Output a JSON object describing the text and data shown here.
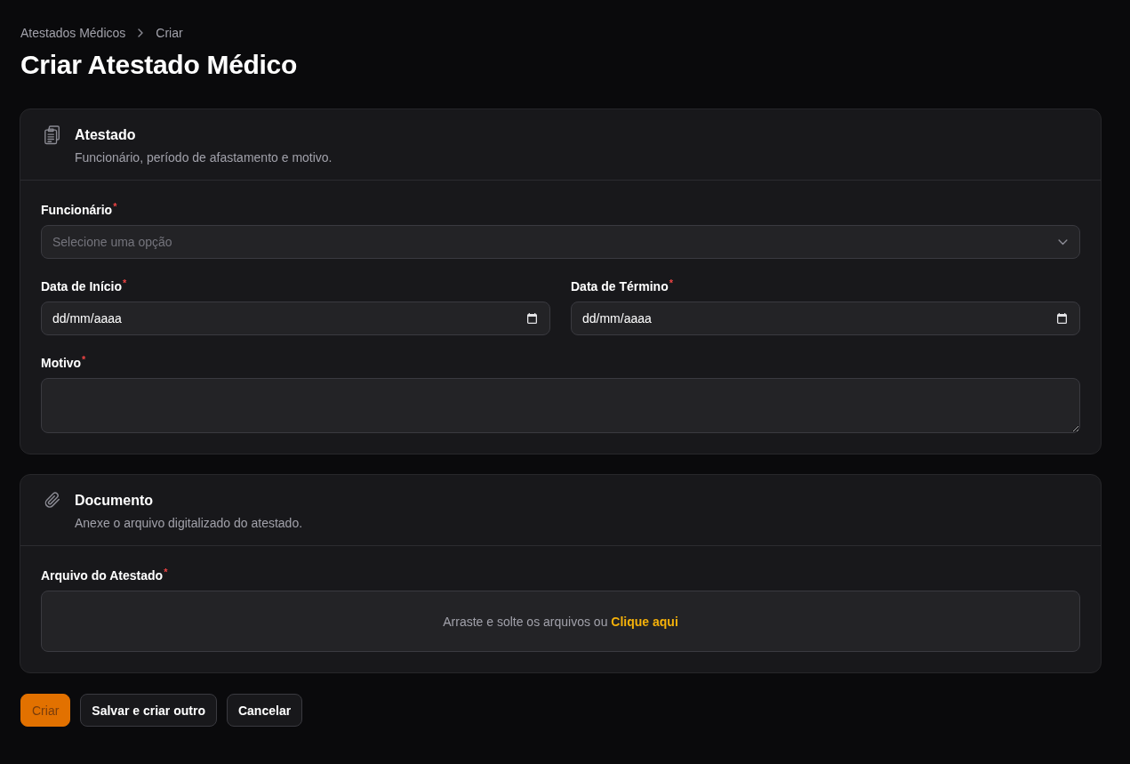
{
  "breadcrumbs": [
    {
      "label": "Atestados Médicos"
    },
    {
      "label": "Criar"
    }
  ],
  "page_title": "Criar Atestado Médico",
  "sections": [
    {
      "title": "Atestado",
      "description": "Funcionário, período de afastamento e motivo.",
      "fields": [
        {
          "kind": "select",
          "label": "Funcionário",
          "required_mark": "*",
          "placeholder": "Selecione uma opção"
        },
        {
          "kind": "date",
          "label": "Data de Início",
          "required_mark": "*",
          "mask": "dd/mm/aaaa"
        },
        {
          "kind": "date",
          "label": "Data de Término",
          "required_mark": "*",
          "mask": "dd/mm/aaaa"
        },
        {
          "kind": "textarea",
          "label": "Motivo",
          "required_mark": "*"
        }
      ]
    },
    {
      "title": "Documento",
      "description": "Anexe o arquivo digitalizado do atestado.",
      "fields": [
        {
          "kind": "file",
          "label": "Arquivo do Atestado",
          "required_mark": "*",
          "prompt": "Arraste e solte os arquivos ou",
          "link": "Clique aqui"
        }
      ]
    }
  ],
  "actions": [
    {
      "label": "Criar",
      "kind": "primary"
    },
    {
      "label": "Salvar e criar outro",
      "kind": "secondary"
    },
    {
      "label": "Cancelar",
      "kind": "secondary"
    }
  ]
}
